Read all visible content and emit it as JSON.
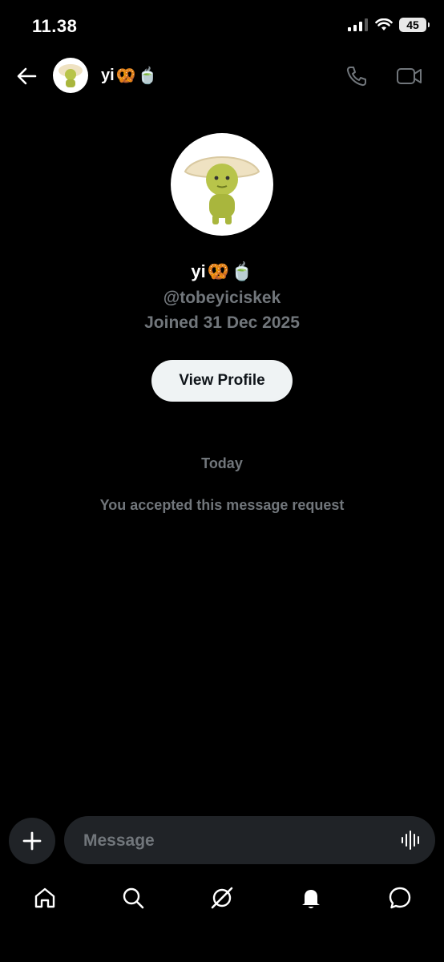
{
  "status_bar": {
    "time": "11.38",
    "battery": "45"
  },
  "header": {
    "contact_name": "yi",
    "emoji_pretzel": "🥨",
    "emoji_tea": "🍵"
  },
  "profile": {
    "name": "yi",
    "handle": "@tobeyiciskek",
    "joined": "Joined 31 Dec 2025",
    "view_profile_label": "View Profile"
  },
  "conversation": {
    "date_separator": "Today",
    "system_message": "You accepted this message request"
  },
  "composer": {
    "placeholder": "Message"
  },
  "icons": {
    "back": "back-arrow-icon",
    "call": "phone-icon",
    "video": "video-camera-icon",
    "add": "plus-icon",
    "voice": "voice-waveform-icon",
    "home": "home-icon",
    "search": "search-icon",
    "grok": "grok-icon",
    "notifications": "bell-icon",
    "messages": "messages-icon"
  },
  "colors": {
    "background": "#000000",
    "secondary_text": "#71767b",
    "button_bg": "#eff3f4",
    "input_bg": "#202327"
  }
}
